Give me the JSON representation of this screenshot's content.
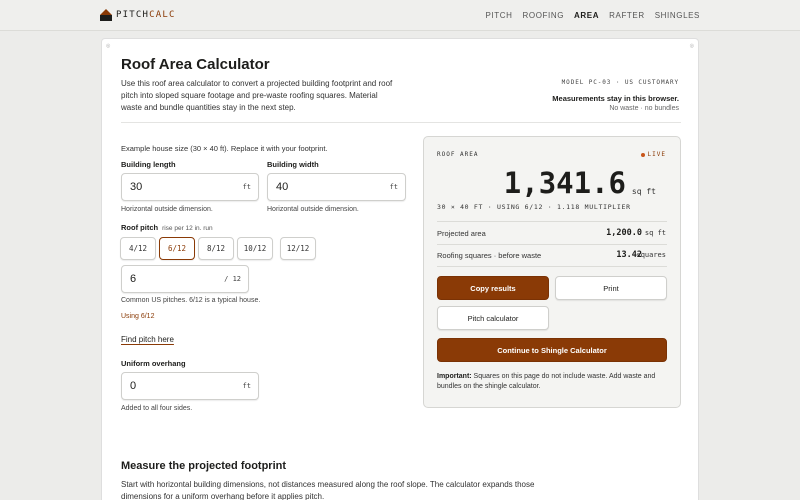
{
  "brand": {
    "name_main": "PITCH",
    "name_accent": "CALC"
  },
  "nav": [
    {
      "label": "PITCH",
      "active": false
    },
    {
      "label": "ROOFING",
      "active": false
    },
    {
      "label": "AREA",
      "active": true
    },
    {
      "label": "RAFTER",
      "active": false
    },
    {
      "label": "SHINGLES",
      "active": false
    }
  ],
  "page": {
    "title": "Roof Area Calculator",
    "intro": "Use this roof area calculator to convert a projected building footprint and roof pitch into sloped square footage and pre-waste roofing squares. Material waste and bundle quantities stay in the next step.",
    "model": "MODEL PC-03 · US CUSTOMARY",
    "stay_note": "Measurements stay in this browser.",
    "stay_sub": "No waste · no bundles"
  },
  "form": {
    "example": "Example house size (30 × 40 ft). Replace it with your footprint.",
    "length": {
      "label": "Building length",
      "value": "30",
      "unit": "ft",
      "hint": "Horizontal outside dimension."
    },
    "width": {
      "label": "Building width",
      "value": "40",
      "unit": "ft",
      "hint": "Horizontal outside dimension."
    },
    "pitch": {
      "label": "Roof pitch",
      "label_sub": "rise per 12 in. run",
      "options": [
        "4/12",
        "6/12",
        "8/12",
        "10/12",
        "12/12"
      ],
      "selected": "6/12",
      "value": "6",
      "unit": "/ 12",
      "hint": "Common US pitches. 6/12 is a typical house.",
      "using": "Using 6/12"
    },
    "find_pitch": "Find pitch here",
    "overhang": {
      "label": "Uniform overhang",
      "value": "0",
      "unit": "ft",
      "hint": "Added to all four sides."
    }
  },
  "results": {
    "label": "ROOF AREA",
    "live": "LIVE",
    "value": "1,341.6",
    "unit": "sq ft",
    "calc": "30 × 40 FT · USING 6/12 · 1.118 MULTIPLIER",
    "rows": [
      {
        "label": "Projected area",
        "value": "1,200.0",
        "unit": "sq ft"
      },
      {
        "label": "Roofing squares · before waste",
        "value": "13.42",
        "unit": "squares"
      }
    ],
    "buttons": {
      "copy": "Copy results",
      "print": "Print",
      "pitch": "Pitch calculator",
      "continue": "Continue to Shingle Calculator"
    },
    "note_strong": "Important:",
    "note": " Squares on this page do not include waste. Add waste and bundles on the shingle calculator."
  },
  "section": {
    "title": "Measure the projected footprint",
    "text": "Start with horizontal building dimensions, not distances measured along the roof slope. The calculator expands those dimensions for a uniform overhang before it applies pitch."
  },
  "colors": {
    "accent": "#8a3a06",
    "live_dot": "#c9561b"
  }
}
